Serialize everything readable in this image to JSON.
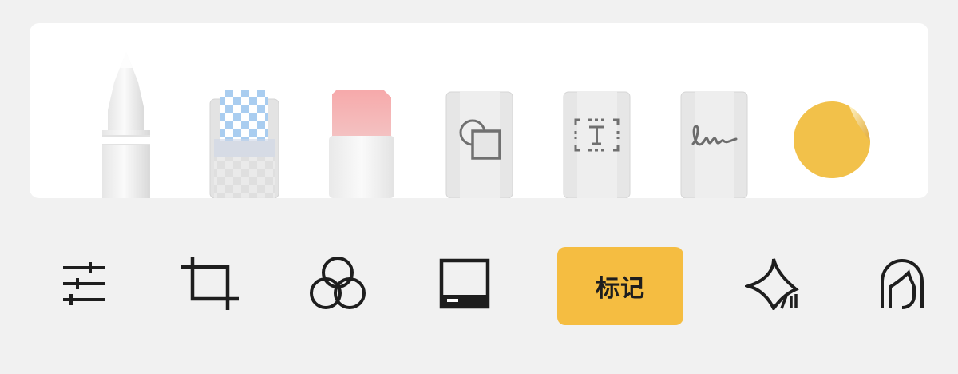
{
  "colors": {
    "background": "#f1f1f1",
    "panel": "#ffffff",
    "accent": "#f5bd41",
    "sticker": "#f2c14a"
  },
  "markup_tools": [
    {
      "name": "pen",
      "icon": "pencil-icon"
    },
    {
      "name": "pixel-eraser",
      "icon": "pixel-eraser-icon"
    },
    {
      "name": "eraser",
      "icon": "eraser-icon"
    },
    {
      "name": "shapes",
      "icon": "shapes-icon"
    },
    {
      "name": "text",
      "icon": "text-box-icon"
    },
    {
      "name": "signature",
      "icon": "signature-icon"
    },
    {
      "name": "sticker",
      "icon": "sticker-icon"
    }
  ],
  "toolbar": {
    "items": [
      {
        "name": "adjust",
        "icon": "sliders-icon"
      },
      {
        "name": "crop",
        "icon": "crop-icon"
      },
      {
        "name": "filters",
        "icon": "filter-circles-icon"
      },
      {
        "name": "frame",
        "icon": "frame-icon"
      },
      {
        "name": "markup",
        "label": "标记",
        "selected": true
      },
      {
        "name": "ai-enhance",
        "icon": "ai-sparkle-icon"
      },
      {
        "name": "portrait",
        "icon": "portrait-icon"
      }
    ]
  }
}
